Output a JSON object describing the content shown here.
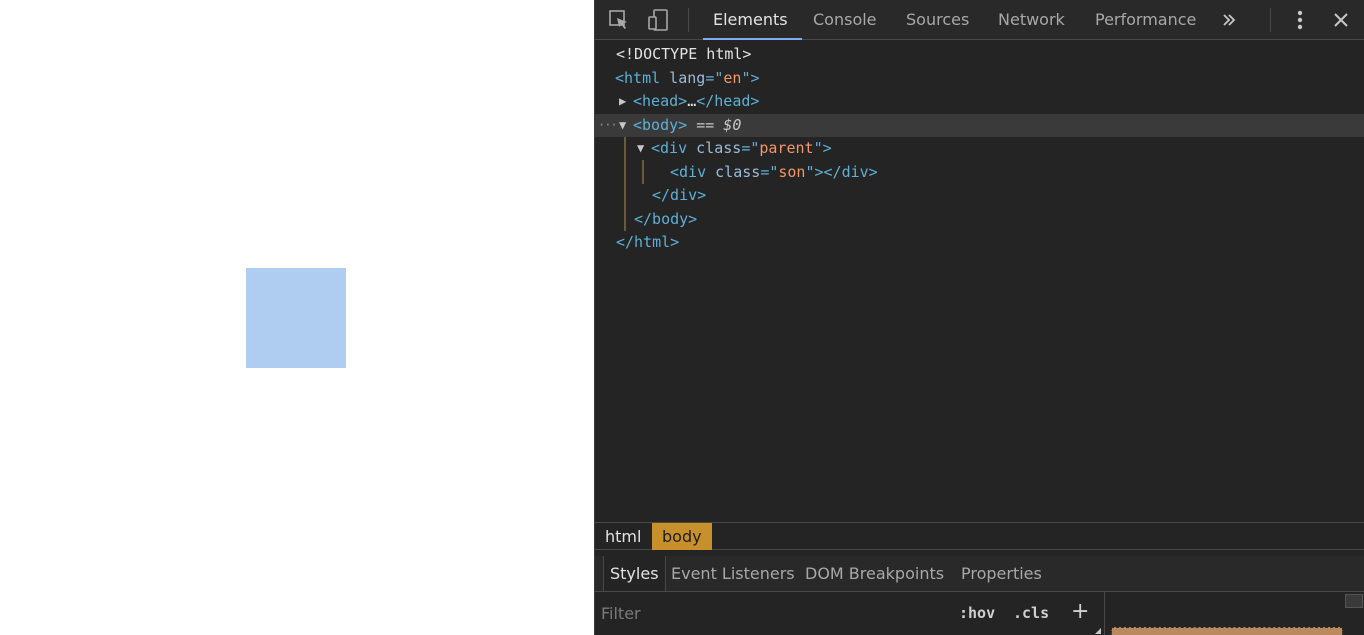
{
  "page": {
    "box_color": "#aecdf0"
  },
  "toolbar": {
    "tabs": [
      {
        "label": "Elements",
        "active": true
      },
      {
        "label": "Console",
        "active": false
      },
      {
        "label": "Sources",
        "active": false
      },
      {
        "label": "Network",
        "active": false
      },
      {
        "label": "Performance",
        "active": false
      }
    ],
    "more_tabs_glyph": "»",
    "menu_glyph": "⋮",
    "close_glyph": "✕"
  },
  "dom_tree": {
    "doctype": "<!DOCTYPE html>",
    "html_open": {
      "tag_open": "<html",
      "attr": " lang",
      "eq": "=\"",
      "val": "en",
      "close": "\">"
    },
    "head": {
      "tag": "<head>",
      "ellipsis": "…",
      "close": "</head>"
    },
    "body": {
      "tag": "<body>",
      "eq_text": " == $0"
    },
    "div_parent": {
      "tag_open": "<div",
      "attr": " class",
      "eq": "=\"",
      "val": "parent",
      "close": "\">"
    },
    "div_son": {
      "tag_open": "<div",
      "attr": " class",
      "eq": "=\"",
      "val": "son",
      "close": "\"></div>"
    },
    "div_close": "</div>",
    "body_close": "</body>",
    "html_close": "</html>",
    "collapsed_glyph": "▶",
    "expanded_glyph": "▼",
    "dots": "···"
  },
  "breadcrumb": [
    {
      "label": "html",
      "selected": false
    },
    {
      "label": "body",
      "selected": true
    }
  ],
  "styles_pane": {
    "tabs": [
      {
        "label": "Styles",
        "active": true
      },
      {
        "label": "Event Listeners",
        "active": false
      },
      {
        "label": "DOM Breakpoints",
        "active": false
      },
      {
        "label": "Properties",
        "active": false
      }
    ],
    "filter_placeholder": "Filter",
    "hov_label": ":hov",
    "cls_label": ".cls",
    "add_label": "+"
  },
  "colors": {
    "accent": "#7cacf8",
    "selected_crumb": "#c8902a",
    "margin_box": "#b98a5e"
  }
}
